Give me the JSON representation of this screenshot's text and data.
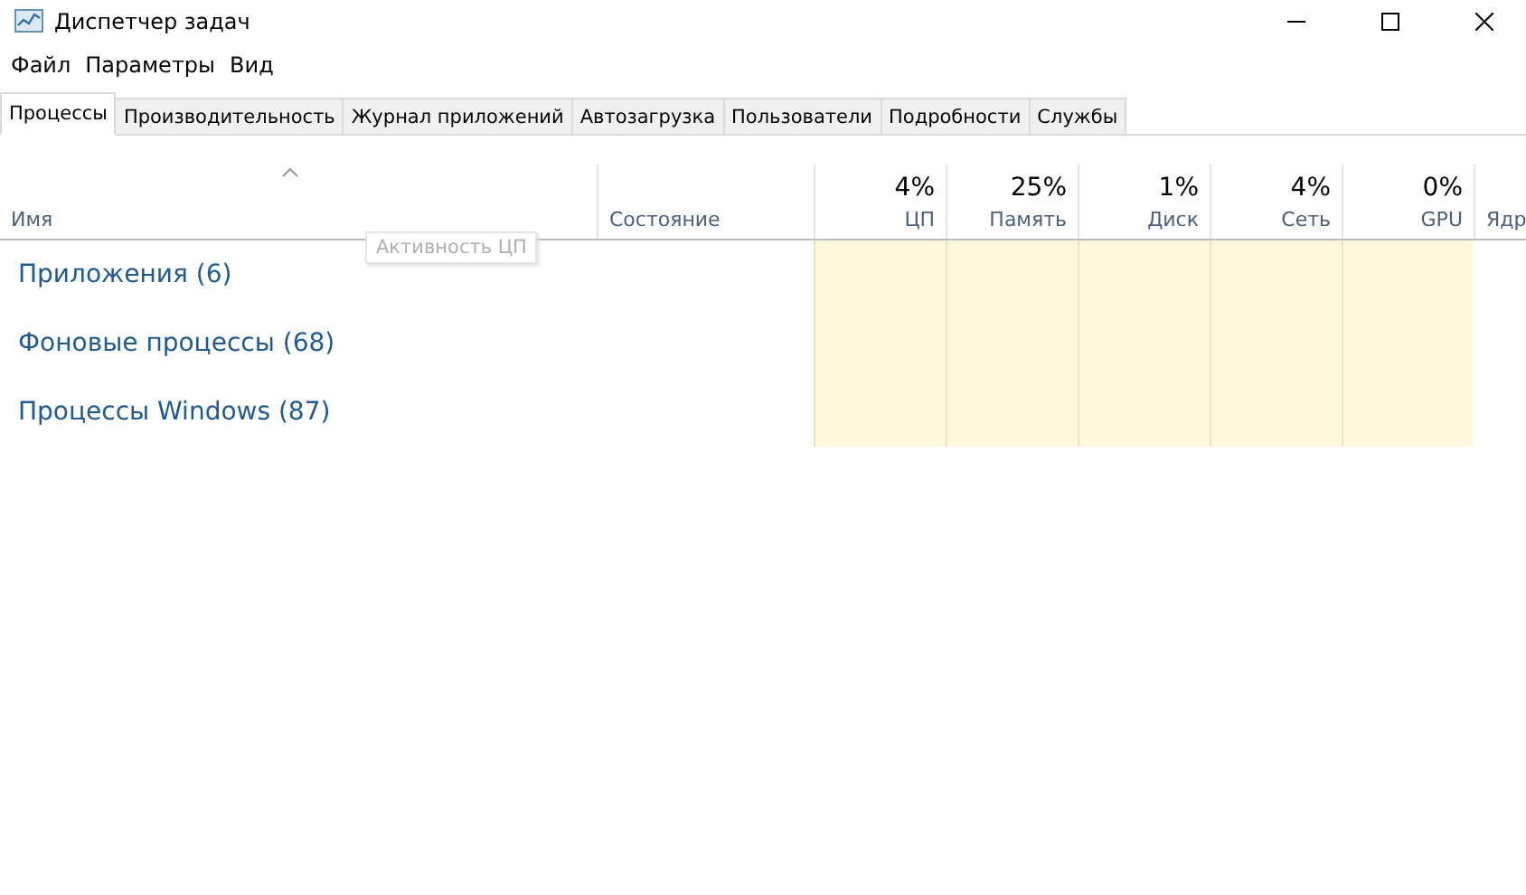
{
  "window": {
    "title": "Диспетчер задач"
  },
  "menu": [
    "Файл",
    "Параметры",
    "Вид"
  ],
  "tabs": [
    {
      "label": "Процессы",
      "selected": true
    },
    {
      "label": "Производительность",
      "selected": false
    },
    {
      "label": "Журнал приложений",
      "selected": false
    },
    {
      "label": "Автозагрузка",
      "selected": false
    },
    {
      "label": "Пользователи",
      "selected": false
    },
    {
      "label": "Подробности",
      "selected": false
    },
    {
      "label": "Службы",
      "selected": false
    }
  ],
  "table": {
    "columns": [
      {
        "kind": "text",
        "label": "Имя"
      },
      {
        "kind": "text",
        "label": "Состояние"
      },
      {
        "kind": "metric",
        "usage": "4%",
        "label": "ЦП"
      },
      {
        "kind": "metric",
        "usage": "25%",
        "label": "Память"
      },
      {
        "kind": "metric",
        "usage": "1%",
        "label": "Диск"
      },
      {
        "kind": "metric",
        "usage": "4%",
        "label": "Сеть"
      },
      {
        "kind": "metric",
        "usage": "0%",
        "label": "GPU"
      },
      {
        "kind": "cut",
        "label": "Ядр"
      }
    ],
    "groups": [
      "Приложения (6)",
      "Фоновые процессы (68)",
      "Процессы Windows (87)"
    ]
  },
  "tooltip": "Активность ЦП"
}
